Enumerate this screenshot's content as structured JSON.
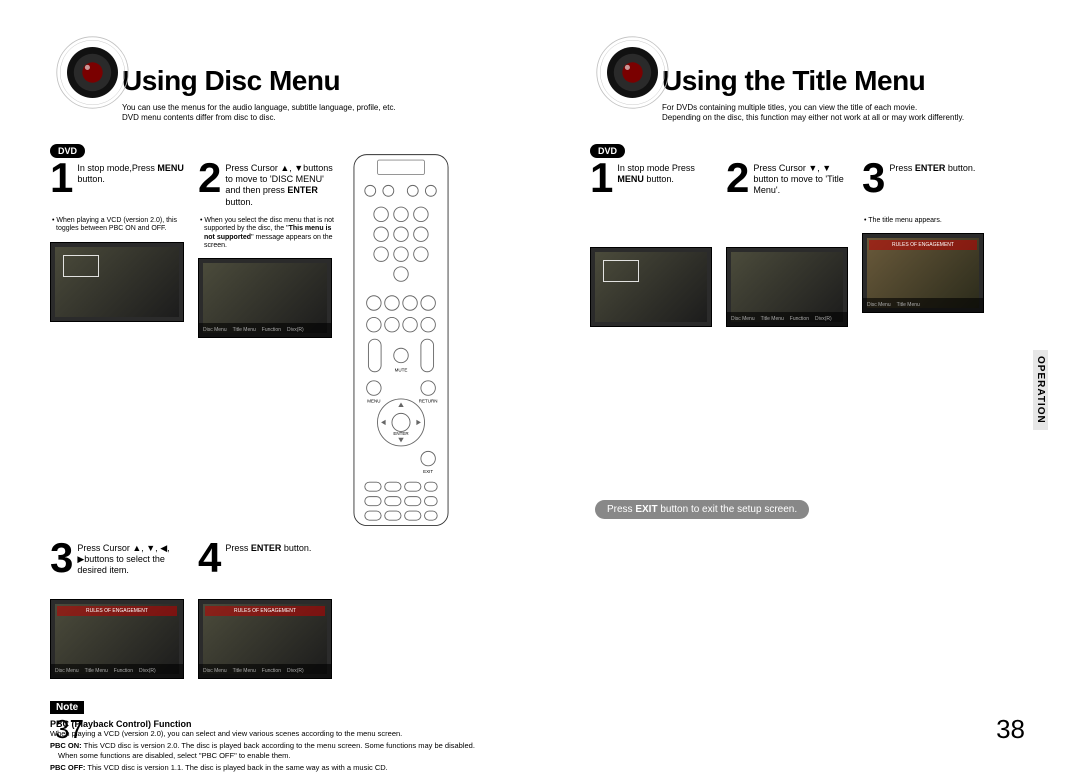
{
  "left": {
    "title": "Using Disc Menu",
    "subtitle": "You can use the menus for the audio language, subtitle language, profile, etc.\nDVD menu contents differ from disc to disc.",
    "dvd_badge": "DVD",
    "steps": {
      "s1": {
        "num": "1",
        "text_a": "In stop mode,Press",
        "text_b": "MENU",
        "text_c": " button.",
        "bullet": "• When playing a VCD (version 2.0), this toggles between PBC ON and OFF."
      },
      "s2": {
        "num": "2",
        "text_a": "Press Cursor ▲, ▼buttons to move to 'DISC MENU' and then press ",
        "text_b": "ENTER",
        "text_c": " button.",
        "bullet_a": "• When you select the disc menu that is not supported by the disc, the \"",
        "bullet_b": "This menu is not supported",
        "bullet_c": "\" message appears on the screen."
      },
      "s3": {
        "num": "3",
        "text_a": "Press Cursor ▲, ▼, ◀, ▶buttons to select the desired item."
      },
      "s4": {
        "num": "4",
        "text_a": "Press ",
        "text_b": "ENTER",
        "text_c": " button."
      }
    },
    "note": {
      "label": "Note",
      "title": "PBC (Playback Control) Function",
      "body_intro": "When playing a VCD (version 2.0), you can select and view various scenes according to the menu screen.",
      "on_label": "PBC ON:",
      "on_text": " This VCD disc is version 2.0. The disc is played back according to the menu screen. Some functions may be disabled. When some functions are disabled, select \"PBC OFF\" to enable them.",
      "off_label": "PBC OFF:",
      "off_text": " This VCD disc is version 1.1. The disc is played back in the same way as with a music CD."
    },
    "page_num": "37"
  },
  "right": {
    "title": "Using the Title Menu",
    "subtitle": "For DVDs containing multiple titles, you can view the title of each movie.\nDepending on the disc, this function may either not work at all or may work differently.",
    "dvd_badge": "DVD",
    "steps": {
      "s1": {
        "num": "1",
        "text_a": "In stop mode Press ",
        "text_b": "MENU",
        "text_c": " button."
      },
      "s2": {
        "num": "2",
        "text_a": "Press Cursor ▼, ▼ button to move to 'Title Menu'."
      },
      "s3": {
        "num": "3",
        "text_a": "Press ",
        "text_b": "ENTER",
        "text_c": " button.",
        "bullet": "• The title menu appears."
      }
    },
    "exit_a": "Press ",
    "exit_b": "EXIT",
    "exit_c": " button to exit the setup screen.",
    "section_tab": "OPERATION",
    "page_num": "38"
  },
  "menu_img_labels": [
    "Disc Menu",
    "Title Menu",
    "Function",
    "Divx(R)"
  ],
  "remote_labels": {
    "menu": "MENU",
    "return": "RETURN",
    "enter": "ENTER",
    "exit": "EXIT",
    "mute": "MUTE"
  }
}
